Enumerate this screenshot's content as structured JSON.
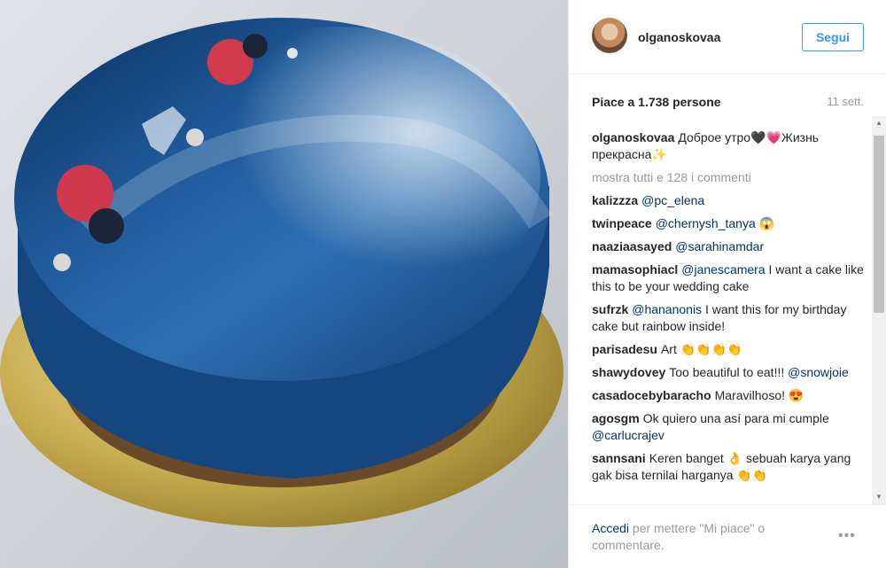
{
  "photo": {
    "alt_icon": "glazed-cake-photo"
  },
  "header": {
    "username": "olganoskovaa",
    "follow_label": "Segui"
  },
  "stats": {
    "likes": "Piace a 1.738 persone",
    "date": "11 sett."
  },
  "caption": {
    "user": "olganoskovaa",
    "text": "Доброе утро🖤💗Жизнь прекрасна✨"
  },
  "show_all": "mostra tutti e 128 i commenti",
  "comments": [
    {
      "user": "kalizzza",
      "mention": "@pc_elena",
      "text": ""
    },
    {
      "user": "twinpeace",
      "mention": "@chernysh_tanya",
      "text": " 😱"
    },
    {
      "user": "naaziaasayed",
      "mention": "@sarahinamdar",
      "text": ""
    },
    {
      "user": "mamasophiacl",
      "mention": "@janescamera",
      "text": " I want a cake like this to be your wedding cake"
    },
    {
      "user": "sufrzk",
      "mention": "@hananonis",
      "text": " I want this for my birthday cake but rainbow inside!"
    },
    {
      "user": "parisadesu",
      "mention": "",
      "text": "Art 👏👏👏👏"
    },
    {
      "user": "shawydovey",
      "mention": "@snowjoie",
      "text": "Too beautiful to eat!!! "
    },
    {
      "user": "casadocebybaracho",
      "mention": "",
      "text": "Maravilhoso! 😍"
    },
    {
      "user": "agosgm",
      "mention": "@carlucrajev",
      "text": "Ok quiero una así para mi cumple "
    },
    {
      "user": "sannsani",
      "mention": "",
      "text": "Keren banget 👌 sebuah karya yang gak bisa ternilai harganya 👏👏"
    }
  ],
  "footer": {
    "login": "Accedi",
    "rest": " per mettere \"Mi piace\" o commentare.",
    "more": "•••"
  }
}
